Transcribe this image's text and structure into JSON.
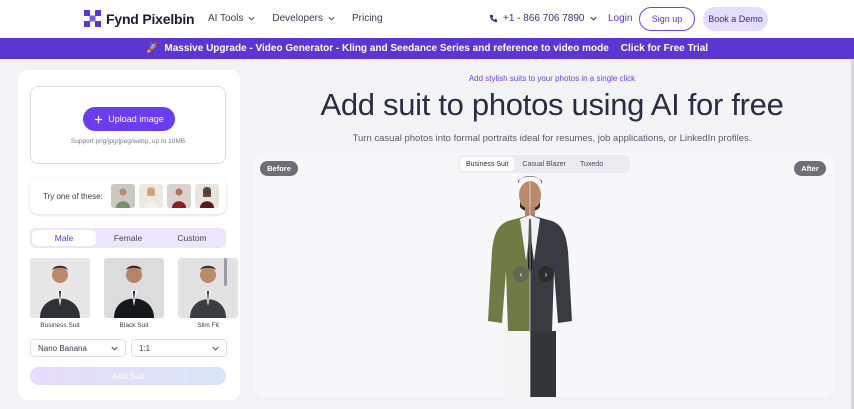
{
  "header": {
    "logo_text": "Fynd Pixelbin",
    "nav": [
      {
        "label": "AI Tools",
        "has_dropdown": true
      },
      {
        "label": "Developers",
        "has_dropdown": true
      },
      {
        "label": "Pricing",
        "has_dropdown": false
      }
    ],
    "phone": "+1 - 866 706 7890",
    "login": "Login",
    "signup": "Sign up",
    "book_demo": "Book a Demo"
  },
  "banner": {
    "icon": "rocket-icon",
    "text": "Massive Upgrade - Video Generator - Kling and Seedance Series and reference to video mode",
    "cta": "Click for Free Trial"
  },
  "left_panel": {
    "upload_label": "Upload image",
    "upload_hint": "Support png/jpg/jpeg/webp, up to 10MB",
    "try_label": "Try one of these:",
    "gender_tabs": [
      "Male",
      "Female",
      "Custom"
    ],
    "active_gender": "Male",
    "styles": [
      {
        "label": "Business Suit"
      },
      {
        "label": "Black Suit"
      },
      {
        "label": "Slim Fit"
      }
    ],
    "model_select": "Nano Banana",
    "ratio_select": "1:1",
    "add_button": "Add Suit"
  },
  "main": {
    "tagline": "Add stylish suits to your photos in a single click",
    "title": "Add suit to photos using AI for free",
    "description": "Turn casual photos into formal portraits ideal for resumes, job applications, or LinkedIn profiles.",
    "compare_tabs": [
      "Business Suit",
      "Casual Blazer",
      "Tuxedo"
    ],
    "active_compare_tab": "Business Suit",
    "before_label": "Before",
    "after_label": "After"
  },
  "colors": {
    "brand": "#5c36d3",
    "accent": "#6a3df0"
  }
}
